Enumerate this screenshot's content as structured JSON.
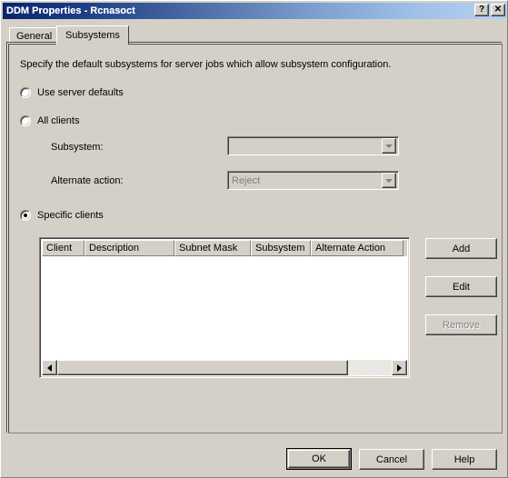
{
  "window": {
    "title": "DDM Properties - Rcnasoct",
    "titlebar_buttons": [
      {
        "name": "help-titlebar-button",
        "glyph": "?"
      },
      {
        "name": "close-titlebar-button",
        "glyph": "✕"
      }
    ]
  },
  "tabs": [
    {
      "label": "General",
      "active": false
    },
    {
      "label": "Subsystems",
      "active": true
    }
  ],
  "panel": {
    "description": "Specify the default subsystems for server jobs which allow subsystem configuration.",
    "radios": [
      {
        "label": "Use server defaults",
        "checked": false
      },
      {
        "label": "All clients",
        "checked": false
      },
      {
        "label": "Specific clients",
        "checked": true
      }
    ],
    "fields": [
      {
        "label": "Subsystem:",
        "value": "",
        "enabled": false
      },
      {
        "label": "Alternate action:",
        "value": "Reject",
        "enabled": false
      }
    ],
    "list": {
      "columns": [
        "Client",
        "Description",
        "Subnet Mask",
        "Subsystem",
        "Alternate Action"
      ],
      "rows": []
    },
    "side_buttons": [
      {
        "label": "Add",
        "enabled": true
      },
      {
        "label": "Edit",
        "enabled": true
      },
      {
        "label": "Remove",
        "enabled": false
      }
    ]
  },
  "dialog_buttons": [
    {
      "label": "OK",
      "default": true
    },
    {
      "label": "Cancel",
      "default": false
    },
    {
      "label": "Help",
      "default": false
    }
  ],
  "colors": {
    "face": "#d4d0c8",
    "title_start": "#0a246a",
    "title_end": "#b4d2f0",
    "disabled_text": "#808080",
    "window_bg": "#ffffff"
  }
}
